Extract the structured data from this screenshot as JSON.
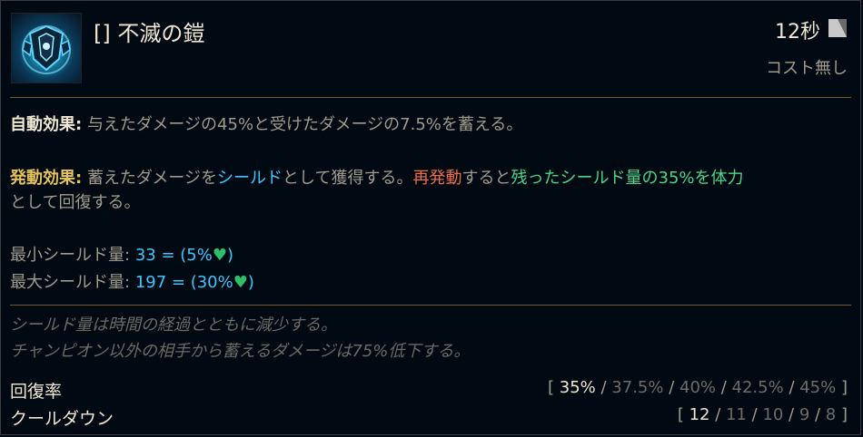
{
  "ability": {
    "title": "[] 不滅の鎧",
    "cooldown": "12秒",
    "cooldown_icon": "cooldown-icon",
    "cost": "コスト無し",
    "icon": "armor-ability-icon"
  },
  "passive": {
    "label": "自動効果:",
    "text": "与えたダメージの45%と受けたダメージの7.5%を蓄える。"
  },
  "active": {
    "label": "発動効果:",
    "seg1": "蓄えたダメージを",
    "seg2": "シールド",
    "seg3": "として獲得する。",
    "seg4": "再発動",
    "seg5": "すると",
    "seg6": "残ったシールド量の35%を体力",
    "seg7": "として回復する。"
  },
  "shield_min": {
    "label": "最小シールド量:",
    "value": "33 = (5%",
    "close": ")",
    "heart_icon": "health-heart-icon"
  },
  "shield_max": {
    "label": "最大シールド量:",
    "value": "197 = (30%",
    "close": ")",
    "heart_icon": "health-heart-icon"
  },
  "notes": [
    "シールド量は時間の経過とともに減少する。",
    "チャンピオン以外の相手から蓄えるダメージは75%低下する。"
  ],
  "stats": {
    "heal_rate": {
      "label": "回復率",
      "open": "[ ",
      "values": [
        "35%",
        "37.5%",
        "40%",
        "42.5%",
        "45%"
      ],
      "sep": " / ",
      "close": " ]"
    },
    "cooldown": {
      "label": "クールダウン",
      "open": "[ ",
      "values": [
        "12",
        "11",
        "10",
        "9",
        "8"
      ],
      "sep": " / ",
      "close": " ]"
    }
  },
  "colors": {
    "shield_blue": "#3ec6ff",
    "recast_red": "#ec6d48",
    "heal_green": "#4bd58a",
    "divider_gold": "#785a28"
  }
}
